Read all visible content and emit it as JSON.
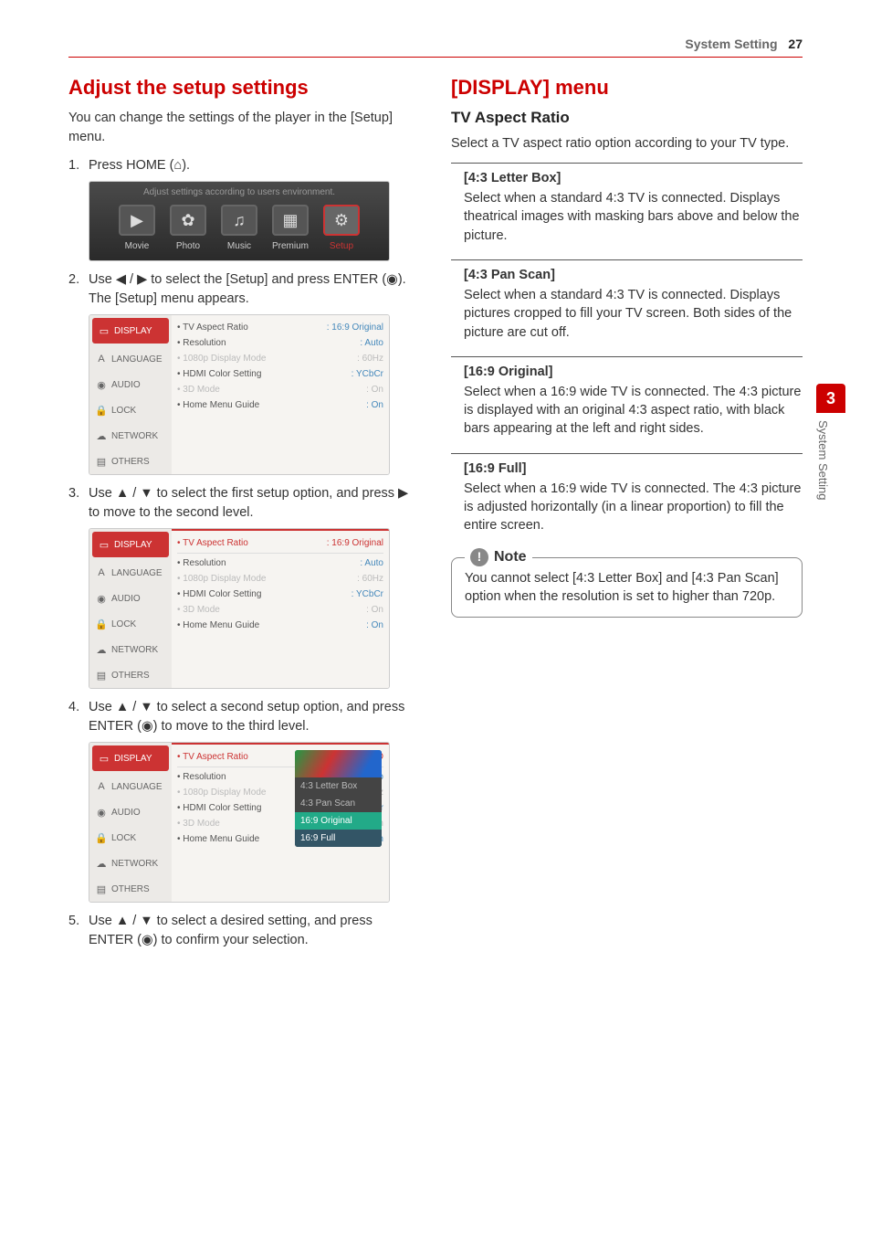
{
  "header": {
    "section": "System Setting",
    "page": "27"
  },
  "side_tab": {
    "number": "3",
    "label": "System Setting"
  },
  "left": {
    "heading": "Adjust the setup settings",
    "intro": "You can change the settings of the player in the [Setup] menu.",
    "steps": {
      "s1_num": "1.",
      "s1_txt_a": "Press HOME (",
      "s1_txt_b": ").",
      "s2_num": "2.",
      "s2_txt_a": "Use ",
      "s2_txt_b": " to select the [Setup] and press ENTER (",
      "s2_txt_c": "). The [Setup] menu appears.",
      "s3_num": "3.",
      "s3_txt_a": "Use ",
      "s3_txt_b": " to select the first setup option, and press ",
      "s3_txt_c": " to move to the second level.",
      "s4_num": "4.",
      "s4_txt_a": "Use ",
      "s4_txt_b": " to select a second setup option, and press ENTER (",
      "s4_txt_c": ") to move to the third level.",
      "s5_num": "5.",
      "s5_txt_a": "Use ",
      "s5_txt_b": " to select a desired setting, and press ENTER (",
      "s5_txt_c": ") to confirm your selection."
    },
    "icons": {
      "home": "⌂",
      "left": "◀",
      "right": "▶",
      "enter": "◉",
      "up": "▲",
      "down": "▼",
      "slash": " / "
    },
    "shot1": {
      "banner": "Adjust settings according to users environment.",
      "items": [
        {
          "label": "Movie",
          "glyph": "▶"
        },
        {
          "label": "Photo",
          "glyph": "✿"
        },
        {
          "label": "Music",
          "glyph": "♫"
        },
        {
          "label": "Premium",
          "glyph": "▦"
        },
        {
          "label": "Setup",
          "glyph": "⚙"
        }
      ]
    },
    "sidemenu": [
      {
        "label": "DISPLAY"
      },
      {
        "label": "LANGUAGE"
      },
      {
        "label": "AUDIO"
      },
      {
        "label": "LOCK"
      },
      {
        "label": "NETWORK"
      },
      {
        "label": "OTHERS"
      }
    ],
    "opts": [
      {
        "k": "• TV Aspect Ratio",
        "v": ": 16:9 Original"
      },
      {
        "k": "• Resolution",
        "v": ": Auto"
      },
      {
        "k": "• 1080p Display Mode",
        "v": ": 60Hz",
        "dim": true
      },
      {
        "k": "• HDMI Color Setting",
        "v": ": YCbCr"
      },
      {
        "k": "• 3D Mode",
        "v": ": On",
        "dim": true
      },
      {
        "k": "• Home Menu Guide",
        "v": ": On"
      }
    ],
    "shot4_opts": [
      {
        "k": "• TV Aspect Ratio",
        "v": ": 16:9 O"
      },
      {
        "k": "• Resolution",
        "v": ": Auto"
      },
      {
        "k": "• 1080p Display Mode",
        "v": ": 60Hz",
        "dim": true
      },
      {
        "k": "• HDMI Color Setting",
        "v": ": YCbCr"
      },
      {
        "k": "• 3D Mode",
        "v": ": On",
        "dim": true
      },
      {
        "k": "• Home Menu Guide",
        "v": ": On"
      }
    ],
    "popup": [
      "4:3 Letter Box",
      "4:3 Pan Scan",
      "16:9 Original",
      "16:9 Full"
    ]
  },
  "right": {
    "heading": "[DISPLAY] menu",
    "aspect_heading": "TV Aspect Ratio",
    "aspect_intro": "Select a TV aspect ratio option according to your TV type.",
    "options": [
      {
        "title": "[4:3 Letter Box]",
        "desc": "Select when a standard 4:3 TV is connected. Displays theatrical images with masking bars above and below the picture."
      },
      {
        "title": "[4:3 Pan Scan]",
        "desc": "Select when a standard 4:3 TV is connected. Displays pictures cropped to fill your TV screen. Both sides of the picture are cut off."
      },
      {
        "title": "[16:9 Original]",
        "desc": "Select when a 16:9 wide TV is connected. The 4:3 picture is displayed with an original 4:3 aspect ratio, with black bars appearing at the left and right sides."
      },
      {
        "title": "[16:9 Full]",
        "desc": "Select when a 16:9 wide TV is connected. The 4:3 picture is adjusted horizontally (in a linear proportion) to fill the entire screen."
      }
    ],
    "note_label": "Note",
    "note_text": "You cannot select [4:3 Letter Box] and [4:3 Pan Scan] option when the resolution is set to higher than 720p."
  }
}
